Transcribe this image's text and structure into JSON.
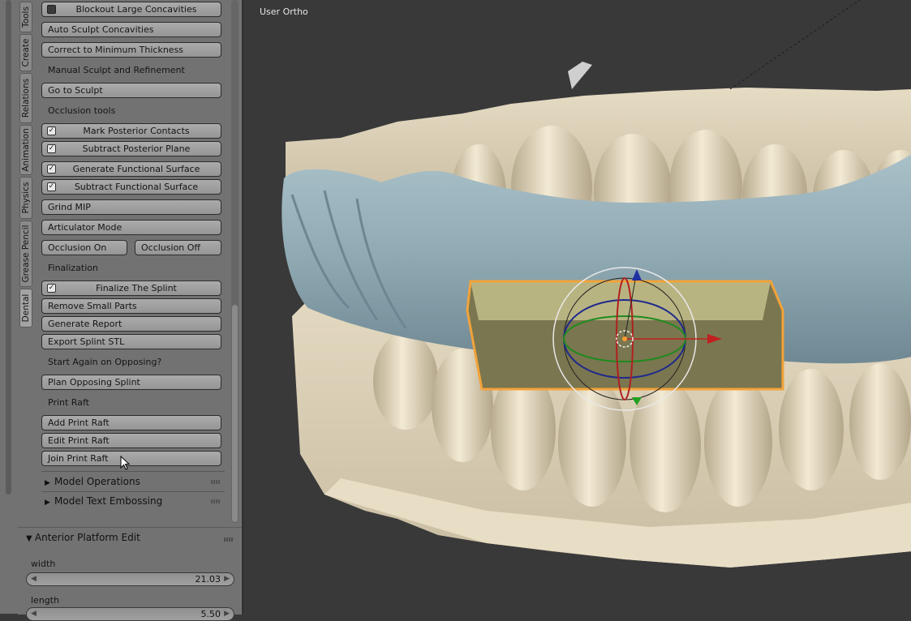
{
  "tabs": [
    "Tools",
    "Create",
    "Relations",
    "Animation",
    "Physics",
    "Grease Pencil",
    "Dental"
  ],
  "active_tab": "Dental",
  "panel": {
    "blockout_large": "Blockout Large Concavities",
    "auto_sculpt": "Auto Sculpt Concavities",
    "correct_min": "Correct to Minimum Thickness",
    "manual_sculpt_label": "Manual Sculpt and Refinement",
    "go_to_sculpt": "Go to Sculpt",
    "occlusion_tools_label": "Occlusion tools",
    "mark_posterior": "Mark Posterior Contacts",
    "subtract_posterior": "Subtract Posterior Plane",
    "generate_functional": "Generate Functional Surface",
    "subtract_functional": "Subtract Functional Surface",
    "grind_mip": "Grind MIP",
    "articulator_mode": "Articulator Mode",
    "occlusion_on": "Occlusion On",
    "occlusion_off": "Occlusion Off",
    "finalization_label": "Finalization",
    "finalize_splint": "Finalize The Splint",
    "remove_small": "Remove Small Parts",
    "generate_report": "Generate Report",
    "export_stl": "Export Splint STL",
    "start_again_label": "Start Again on Opposing?",
    "plan_opposing": "Plan Opposing Splint",
    "print_raft_label": "Print Raft",
    "add_raft": "Add Print Raft",
    "edit_raft": "Edit Print Raft",
    "join_raft": "Join Print Raft",
    "model_operations": "Model Operations",
    "model_text": "Model Text Embossing"
  },
  "operator_panel": {
    "title": "Anterior Platform Edit",
    "width_label": "width",
    "width_value": "21.03",
    "length_label": "length",
    "length_value": "5.50"
  },
  "viewport": {
    "view_label": "User Ortho"
  },
  "colors": {
    "panel_bg": "#727272",
    "viewport_bg": "#393939",
    "teeth": "#d8ccb2",
    "splint": "#8fa9b3",
    "selection": "#f2a33a",
    "block": "#8e8a5a"
  },
  "icons": {
    "cursor": "arrow-cursor",
    "gizmo": "transform-gizmo"
  }
}
